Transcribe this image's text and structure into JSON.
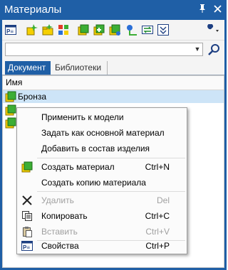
{
  "window": {
    "title": "Материалы"
  },
  "titlebar_buttons": [
    {
      "name": "pin-icon",
      "glyph": "⬢"
    },
    {
      "name": "close-icon",
      "glyph": "✕"
    }
  ],
  "toolbar": {
    "icons": [
      "properties-icon",
      "new-material-icon",
      "new-library-material-icon",
      "material-grid-icon",
      "material-a-icon",
      "material-b-icon",
      "material-c-icon",
      "material-link-icon",
      "swap-icon",
      "filter-icon",
      "wrench-icon"
    ]
  },
  "search": {
    "value": "",
    "placeholder": ""
  },
  "tabs": [
    {
      "label": "Документ",
      "active": true
    },
    {
      "label": "Библиотеки",
      "active": false
    }
  ],
  "list": {
    "column_header": "Имя",
    "rows": [
      {
        "label": "Бронза",
        "selected": true
      }
    ]
  },
  "context_menu": {
    "items": [
      {
        "label": "Применить к модели",
        "shortcut": "",
        "enabled": true,
        "icon": ""
      },
      {
        "label": "Задать как основной материал",
        "shortcut": "",
        "enabled": true,
        "icon": ""
      },
      {
        "label": "Добавить в состав изделия",
        "shortcut": "",
        "enabled": true,
        "icon": ""
      },
      {
        "label": "Создать материал",
        "shortcut": "Ctrl+N",
        "enabled": true,
        "icon": "create-material-icon"
      },
      {
        "label": "Создать копию материала",
        "shortcut": "",
        "enabled": true,
        "icon": ""
      },
      {
        "label": "Удалить",
        "shortcut": "Del",
        "enabled": false,
        "icon": "delete-icon"
      },
      {
        "label": "Копировать",
        "shortcut": "Ctrl+C",
        "enabled": true,
        "icon": "copy-icon"
      },
      {
        "label": "Вставить",
        "shortcut": "Ctrl+V",
        "enabled": false,
        "icon": "paste-icon"
      },
      {
        "label": "Свойства",
        "shortcut": "Ctrl+P",
        "enabled": true,
        "icon": "properties-icon"
      }
    ]
  },
  "colors": {
    "titlebar": "#1f5fa6",
    "selection": "#cde4f7",
    "accent_yellow": "#f5d000",
    "accent_green": "#3cae35"
  }
}
